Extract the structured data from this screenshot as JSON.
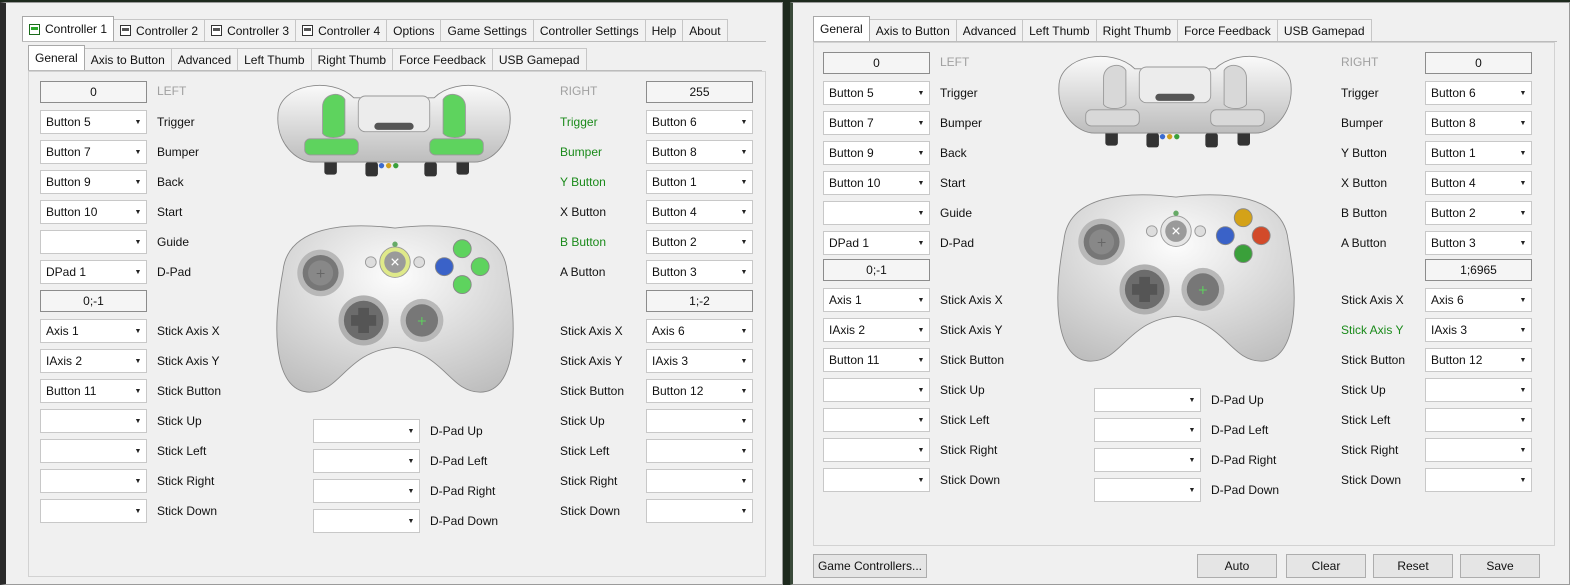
{
  "left_window": {
    "top_tabs": [
      "Controller 1",
      "Controller 2",
      "Controller 3",
      "Controller 4",
      "Options",
      "Game Settings",
      "Controller Settings",
      "Help",
      "About"
    ],
    "sub_tabs": [
      "General",
      "Axis to Button",
      "Advanced",
      "Left Thumb",
      "Right Thumb",
      "Force Feedback",
      "USB Gamepad"
    ],
    "left_value": "0",
    "left_header": "LEFT",
    "right_header": "RIGHT",
    "right_value": "255",
    "left_stick_value": "0;-1",
    "right_stick_value": "1;-2",
    "left_rows": [
      {
        "value": "Button 5",
        "label": "Trigger"
      },
      {
        "value": "Button 7",
        "label": "Bumper"
      },
      {
        "value": "Button 9",
        "label": "Back"
      },
      {
        "value": "Button 10",
        "label": "Start"
      },
      {
        "value": "",
        "label": "Guide"
      },
      {
        "value": "DPad 1",
        "label": "D-Pad"
      }
    ],
    "left_stick_rows": [
      {
        "value": "Axis 1",
        "label": "Stick Axis X"
      },
      {
        "value": "IAxis 2",
        "label": "Stick Axis Y"
      },
      {
        "value": "Button 11",
        "label": "Stick Button"
      },
      {
        "value": "",
        "label": "Stick Up"
      },
      {
        "value": "",
        "label": "Stick Left"
      },
      {
        "value": "",
        "label": "Stick Right"
      },
      {
        "value": "",
        "label": "Stick Down"
      }
    ],
    "right_rows": [
      {
        "label": "Trigger",
        "value": "Button 6",
        "highlight": true
      },
      {
        "label": "Bumper",
        "value": "Button 8",
        "highlight": true
      },
      {
        "label": "Y Button",
        "value": "Button 1",
        "highlight": true
      },
      {
        "label": "X Button",
        "value": "Button 4",
        "highlight": false
      },
      {
        "label": "B Button",
        "value": "Button 2",
        "highlight": true
      },
      {
        "label": "A Button",
        "value": "Button 3",
        "highlight": false
      }
    ],
    "right_stick_rows": [
      {
        "label": "Stick Axis X",
        "value": "Axis 6",
        "highlight": false
      },
      {
        "label": "Stick Axis Y",
        "value": "IAxis 3",
        "highlight": false
      },
      {
        "label": "Stick Button",
        "value": "Button 12",
        "highlight": false
      },
      {
        "label": "Stick Up",
        "value": "",
        "highlight": false
      },
      {
        "label": "Stick Left",
        "value": "",
        "highlight": false
      },
      {
        "label": "Stick Right",
        "value": "",
        "highlight": false
      },
      {
        "label": "Stick Down",
        "value": "",
        "highlight": false
      }
    ],
    "dpad_rows": [
      {
        "value": "",
        "label": "D-Pad Up"
      },
      {
        "value": "",
        "label": "D-Pad Left"
      },
      {
        "value": "",
        "label": "D-Pad Right"
      },
      {
        "value": "",
        "label": "D-Pad Down"
      }
    ]
  },
  "right_window": {
    "sub_tabs": [
      "General",
      "Axis to Button",
      "Advanced",
      "Left Thumb",
      "Right Thumb",
      "Force Feedback",
      "USB Gamepad"
    ],
    "left_value": "0",
    "left_header": "LEFT",
    "right_header": "RIGHT",
    "right_value": "0",
    "left_stick_value": "0;-1",
    "right_stick_value": "1;6965",
    "left_rows": [
      {
        "value": "Button 5",
        "label": "Trigger"
      },
      {
        "value": "Button 7",
        "label": "Bumper"
      },
      {
        "value": "Button 9",
        "label": "Back"
      },
      {
        "value": "Button 10",
        "label": "Start"
      },
      {
        "value": "",
        "label": "Guide"
      },
      {
        "value": "DPad 1",
        "label": "D-Pad"
      }
    ],
    "left_stick_rows": [
      {
        "value": "Axis 1",
        "label": "Stick Axis X"
      },
      {
        "value": "IAxis 2",
        "label": "Stick Axis Y"
      },
      {
        "value": "Button 11",
        "label": "Stick Button"
      },
      {
        "value": "",
        "label": "Stick Up"
      },
      {
        "value": "",
        "label": "Stick Left"
      },
      {
        "value": "",
        "label": "Stick Right"
      },
      {
        "value": "",
        "label": "Stick Down"
      }
    ],
    "right_rows": [
      {
        "label": "Trigger",
        "value": "Button 6",
        "highlight": false
      },
      {
        "label": "Bumper",
        "value": "Button 8",
        "highlight": false
      },
      {
        "label": "Y Button",
        "value": "Button 1",
        "highlight": false
      },
      {
        "label": "X Button",
        "value": "Button 4",
        "highlight": false
      },
      {
        "label": "B Button",
        "value": "Button 2",
        "highlight": false
      },
      {
        "label": "A Button",
        "value": "Button 3",
        "highlight": false
      }
    ],
    "right_stick_rows": [
      {
        "label": "Stick Axis X",
        "value": "Axis 6",
        "highlight": false
      },
      {
        "label": "Stick Axis Y",
        "value": "IAxis 3",
        "highlight": true
      },
      {
        "label": "Stick Button",
        "value": "Button 12",
        "highlight": false
      },
      {
        "label": "Stick Up",
        "value": "",
        "highlight": false
      },
      {
        "label": "Stick Left",
        "value": "",
        "highlight": false
      },
      {
        "label": "Stick Right",
        "value": "",
        "highlight": false
      },
      {
        "label": "Stick Down",
        "value": "",
        "highlight": false
      }
    ],
    "dpad_rows": [
      {
        "value": "",
        "label": "D-Pad Up"
      },
      {
        "value": "",
        "label": "D-Pad Left"
      },
      {
        "value": "",
        "label": "D-Pad Right"
      },
      {
        "value": "",
        "label": "D-Pad Down"
      }
    ],
    "buttons": {
      "game_controllers": "Game Controllers...",
      "auto": "Auto",
      "clear": "Clear",
      "reset": "Reset",
      "save": "Save"
    }
  },
  "colors": {
    "highlight_green": "#1a8a1a",
    "controller_body": "#e8e8e8",
    "window_bg": "#f0f0f0"
  }
}
